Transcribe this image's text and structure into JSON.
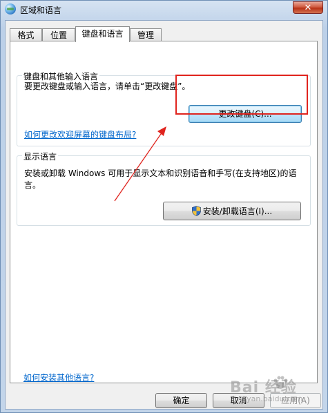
{
  "window": {
    "title": "区域和语言",
    "close_symbol": "✕",
    "app_icon": "globe-icon"
  },
  "tabs": [
    {
      "label": "格式",
      "active": false
    },
    {
      "label": "位置",
      "active": false
    },
    {
      "label": "键盘和语言",
      "active": true
    },
    {
      "label": "管理",
      "active": false
    }
  ],
  "keyboard_group": {
    "title": "键盘和其他输入语言",
    "description": "要更改键盘或输入语言，请单击“更改键盘”。",
    "change_button": "更改键盘(C)...",
    "link": "如何更改欢迎屏幕的键盘布局?"
  },
  "display_group": {
    "title": "显示语言",
    "description": "安装或卸载 Windows 可用于显示文本和识别语音和手写(在支持地区)的语言。",
    "install_button": "安装/卸载语言(I)...",
    "install_icon": "shield-icon"
  },
  "footer": {
    "link": "如何安装其他语言?",
    "ok": "确定",
    "cancel": "取消",
    "apply": "应用(A)"
  },
  "annotation": {
    "box_color": "#e0241e",
    "arrow_color": "#e0241e"
  },
  "watermark": {
    "brand": "Bai  经验",
    "sub": "jingyan.baidu.com"
  }
}
